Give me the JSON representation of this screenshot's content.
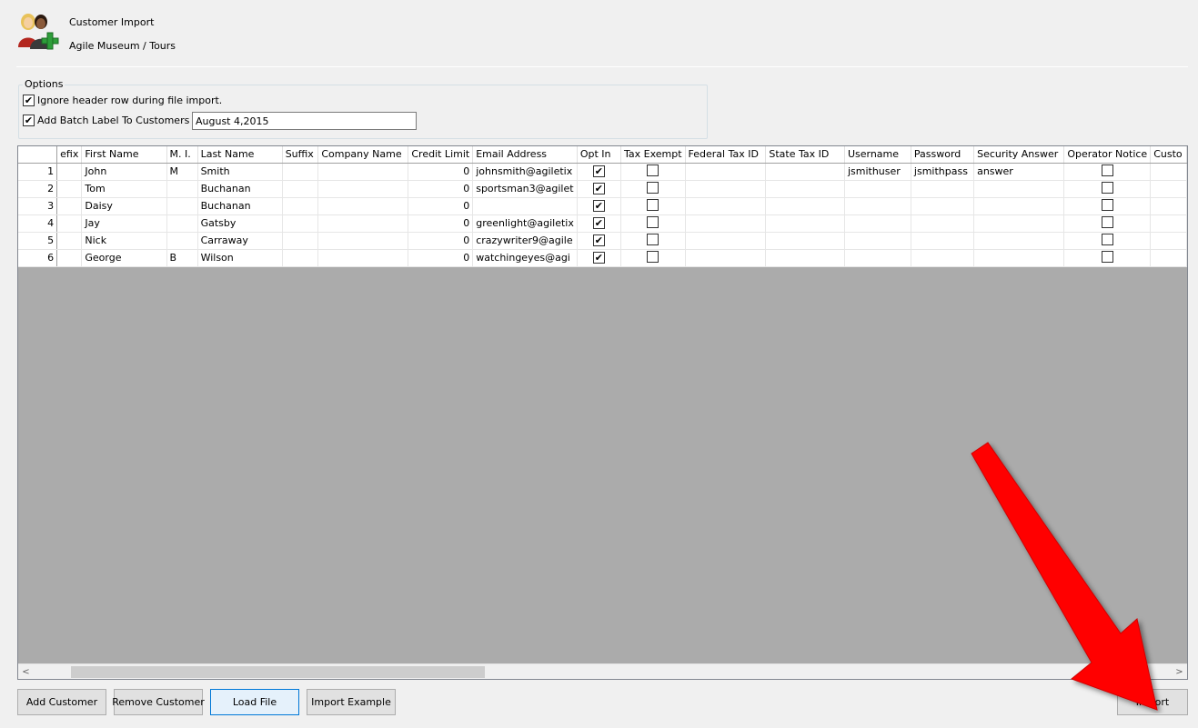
{
  "header": {
    "title": "Customer Import",
    "subtitle": "Agile Museum / Tours"
  },
  "options": {
    "legend": "Options",
    "ignore_header": {
      "label": "Ignore header row during file import.",
      "checked": true
    },
    "batch_label": {
      "label": "Add Batch Label To Customers",
      "checked": true,
      "value": "August 4,2015"
    }
  },
  "grid": {
    "columns": [
      "efix",
      "First Name",
      "M. I.",
      "Last Name",
      "Suffix",
      "Company Name",
      "Credit Limit",
      "Email Address",
      "Opt In",
      "Tax Exempt",
      "Federal Tax ID",
      "State Tax ID",
      "Username",
      "Password",
      "Security Answer",
      "Operator Notice",
      "Custo"
    ],
    "rows": [
      {
        "num": "1",
        "first": "John",
        "mi": "M",
        "last": "Smith",
        "credit": "0",
        "email": "johnsmith@agiletix",
        "opt_in": true,
        "tax_exempt": false,
        "username": "jsmithuser",
        "password": "jsmithpass",
        "security": "answer",
        "notice": false
      },
      {
        "num": "2",
        "first": "Tom",
        "mi": "",
        "last": "Buchanan",
        "credit": "0",
        "email": "sportsman3@agilet",
        "opt_in": true,
        "tax_exempt": false,
        "username": "",
        "password": "",
        "security": "",
        "notice": false
      },
      {
        "num": "3",
        "first": "Daisy",
        "mi": "",
        "last": "Buchanan",
        "credit": "0",
        "email": "",
        "opt_in": true,
        "tax_exempt": false,
        "username": "",
        "password": "",
        "security": "",
        "notice": false
      },
      {
        "num": "4",
        "first": "Jay",
        "mi": "",
        "last": "Gatsby",
        "credit": "0",
        "email": "greenlight@agiletix",
        "opt_in": true,
        "tax_exempt": false,
        "username": "",
        "password": "",
        "security": "",
        "notice": false
      },
      {
        "num": "5",
        "first": "Nick",
        "mi": "",
        "last": "Carraway",
        "credit": "0",
        "email": "crazywriter9@agile",
        "opt_in": true,
        "tax_exempt": false,
        "username": "",
        "password": "",
        "security": "",
        "notice": false
      },
      {
        "num": "6",
        "first": "George",
        "mi": "B",
        "last": "Wilson",
        "credit": "0",
        "email": "watchingeyes@agi",
        "opt_in": true,
        "tax_exempt": false,
        "username": "",
        "password": "",
        "security": "",
        "notice": false
      }
    ]
  },
  "buttons": {
    "add_customer": "Add Customer",
    "remove_customer": "Remove Customer",
    "load_file": "Load File",
    "import_example": "Import Example",
    "import": "Import"
  },
  "scrollbar": {
    "left_arrow": "<",
    "right_arrow": ">"
  },
  "icons": {
    "app": "customers-add-icon",
    "annotation": "red-arrow-icon"
  },
  "colors": {
    "arrow": "#ff0000",
    "grid_bg": "#ababab",
    "load_button_border": "#0078d7"
  }
}
